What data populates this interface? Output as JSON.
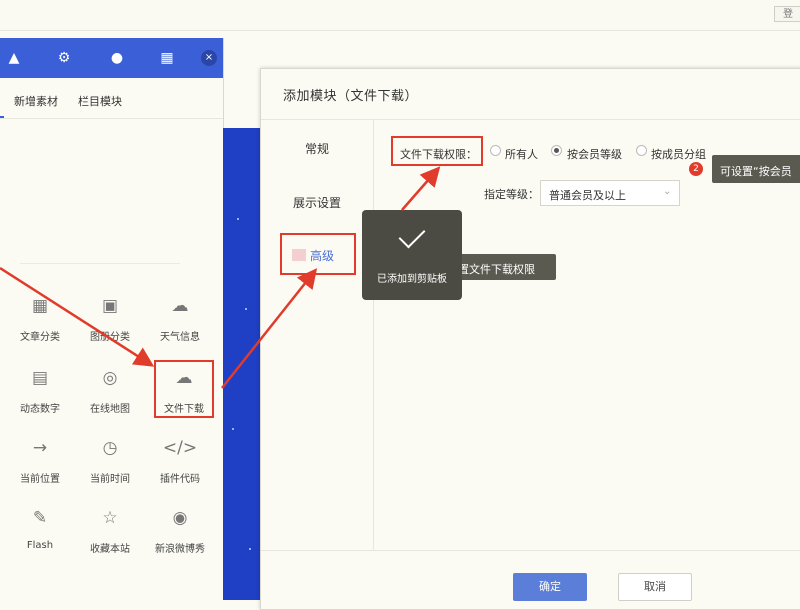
{
  "header": {
    "login_label": "登"
  },
  "panel": {
    "toolbar_icons": [
      "shirt-icon",
      "gear-icon",
      "paw-icon",
      "layout-icon"
    ],
    "close_glyph": "×",
    "tabs": [
      "新增素材",
      "栏目模块"
    ],
    "tiles": [
      {
        "label": "文章分类",
        "icon": "grid-icon"
      },
      {
        "label": "图册分类",
        "icon": "factory-icon"
      },
      {
        "label": "天气信息",
        "icon": "weather-icon"
      },
      {
        "label": "动态数字",
        "icon": "digits-icon"
      },
      {
        "label": "在线地图",
        "icon": "map-icon"
      },
      {
        "label": "文件下载",
        "icon": "cloud-download-icon"
      },
      {
        "label": "当前位置",
        "icon": "breadcrumb-icon"
      },
      {
        "label": "当前时间",
        "icon": "clock-icon"
      },
      {
        "label": "插件代码",
        "icon": "code-icon"
      },
      {
        "label": "Flash",
        "icon": "flash-icon"
      },
      {
        "label": "收藏本站",
        "icon": "star-icon"
      },
      {
        "label": "新浪微博秀",
        "icon": "weibo-icon"
      }
    ]
  },
  "modal": {
    "title": "添加模块（文件下载）",
    "nav": [
      "常规",
      "展示设置",
      "高级"
    ],
    "permission": {
      "label": "文件下载权限：",
      "options": [
        "所有人",
        "按会员等级",
        "按成员分组"
      ],
      "selected": "按会员等级"
    },
    "level": {
      "label": "指定等级：",
      "value": "普通会员及以上"
    },
    "confirm_label": "确定",
    "cancel_label": "取消"
  },
  "tooltips": {
    "badge": "2",
    "tip_right": "可设置“按会员",
    "tip_middle": "置文件下载权限"
  },
  "toast": {
    "text": "已添加到剪贴板"
  },
  "colors": {
    "accent_blue": "#3a5fd6",
    "annotation_red": "#e03b2b",
    "tooltip_bg": "#5a5a50"
  }
}
